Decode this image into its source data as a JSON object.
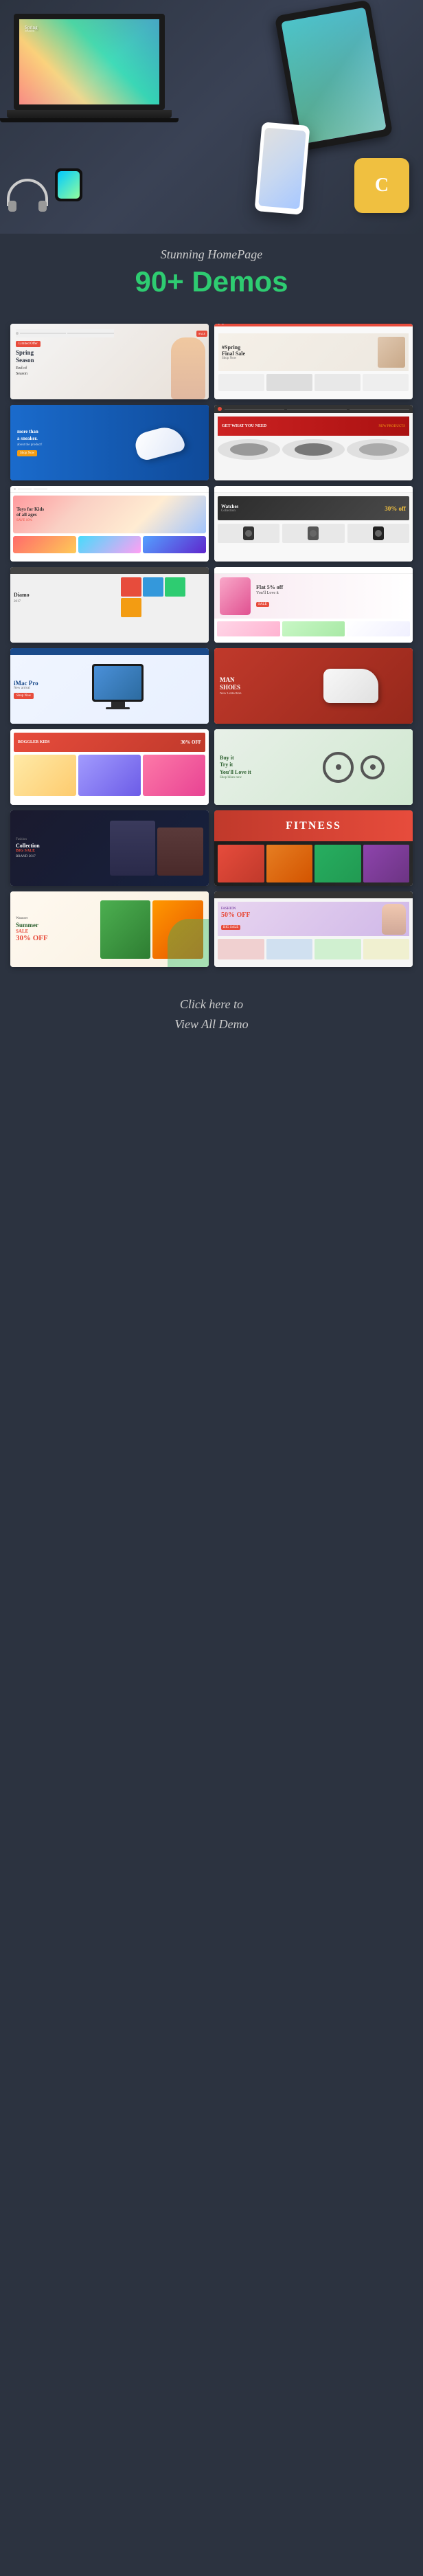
{
  "hero": {
    "devices": [
      "laptop",
      "tablet",
      "phone",
      "watch",
      "headphones"
    ],
    "yellow_card_text": "C"
  },
  "heading": {
    "subtitle": "Stunning HomePage",
    "main_text": "90+ Demos",
    "plus_symbol": "+"
  },
  "demos": [
    {
      "id": 1,
      "title": "Spring Season",
      "subtitle": "End of Season",
      "tag": "Limited Offer",
      "style": "fashion"
    },
    {
      "id": 2,
      "title": "#Spring Final Sale",
      "style": "fashion-sale"
    },
    {
      "id": 3,
      "title": "more than a sneaker.",
      "subtitle": "about the product!",
      "style": "sneaker"
    },
    {
      "id": 4,
      "title": "NEW PRODUCTS",
      "subtitle": "GET WHAT YOU NEED",
      "style": "wheels"
    },
    {
      "id": 5,
      "title": "Toys for Kids of all ages",
      "style": "toys"
    },
    {
      "id": 6,
      "title": "30% off",
      "subtitle": "Watches Collection",
      "style": "watches"
    },
    {
      "id": 7,
      "title": "Diamo",
      "subtitle": "2017",
      "style": "gifts"
    },
    {
      "id": 8,
      "title": "Flat 5% off",
      "subtitle": "You'll Love it",
      "style": "cosmetics"
    },
    {
      "id": 9,
      "title": "iMac Pro",
      "style": "electronics"
    },
    {
      "id": 10,
      "title": "MAN SHOES",
      "style": "shoes"
    },
    {
      "id": 11,
      "title": "BOGGLER KIDS",
      "discount": "30% OFF",
      "style": "kids"
    },
    {
      "id": 12,
      "title": "Buy it Try it You'll Love it",
      "style": "bicycle"
    },
    {
      "id": 13,
      "title": "Collection",
      "subtitle": "BRAND 2017",
      "discount": "BIG SALE",
      "style": "fashion-dark"
    },
    {
      "id": 14,
      "title": "FITNESS",
      "style": "fitness"
    },
    {
      "id": 15,
      "title": "Summer SALE",
      "subtitle": "Wanneer",
      "discount": "30% OFF",
      "style": "summer"
    },
    {
      "id": 16,
      "title": "FASHION",
      "discount": "50% OFF",
      "tag": "BIG SALE",
      "style": "fashion-sale2"
    }
  ],
  "cta": {
    "line1": "Click here to",
    "line2": "View All Demo"
  }
}
